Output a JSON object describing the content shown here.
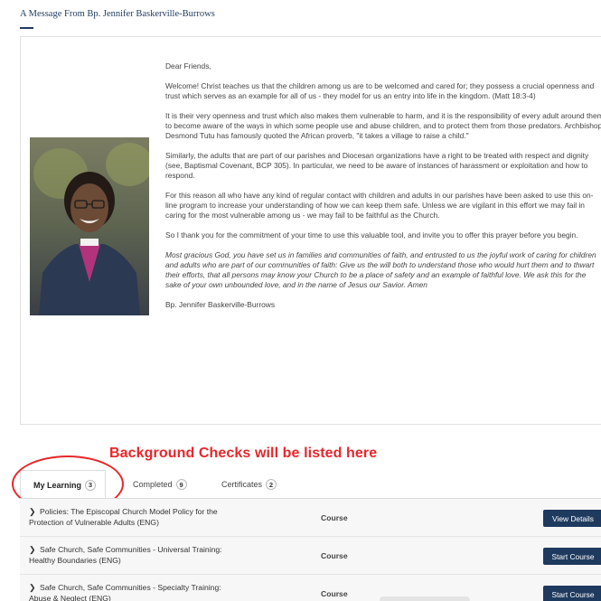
{
  "message": {
    "heading": "A Message From Bp. Jennifer Baskerville-Burrows",
    "paragraphs": [
      "Dear Friends,",
      "Welcome! Christ teaches us that the children among us are to be welcomed and cared for; they possess a crucial openness and trust which serves as an example for all of us - they model for us an entry into life in the kingdom. (Matt 18:3-4)",
      "It is their very openness and trust which also makes them vulnerable to harm, and it is the responsibility of every adult around them to become aware of the ways in which some people use and abuse children, and to protect them from those predators. Archbishop Desmond Tutu has famously quoted the African proverb, \"it takes a village to raise a child.\"",
      "Similarly, the adults that are part of our parishes and Diocesan organizations have a right to be treated with respect and dignity (see, Baptismal Covenant, BCP 305). In particular, we need to be aware of instances of harassment or exploitation and how to respond.",
      "For this reason all who have any kind of regular contact with children and adults in our parishes have been asked to use this on-line program to increase your understanding of how we can keep them safe. Unless we are vigilant in this effort we may fail in caring for the most vulnerable among us - we may fail to be faithful as the Church.",
      "So I thank you for the commitment of your time to use this valuable tool, and invite you to offer this prayer before you begin."
    ],
    "prayer": "Most gracious God, you have set us in families and communities of faith, and entrusted to us the joyful work of caring for children and adults who are part of our communities of faith: Give us the will both to understand those who would hurt them and to thwart their efforts, that all persons may know your Church to be a place of safety and an example of faithful love. We ask this for the sake of your own unbounded love, and in the name of Jesus our Savior. Amen",
    "signature": "Bp. Jennifer Baskerville-Burrows"
  },
  "annotation": "Background Checks will be listed here",
  "tabs": [
    {
      "label": "My Learning",
      "count": "3"
    },
    {
      "label": "Completed",
      "count": "9"
    },
    {
      "label": "Certificates",
      "count": "2"
    }
  ],
  "courses": [
    {
      "title": "Policies: The Episcopal Church Model Policy for the Protection of Vulnerable Adults (ENG)",
      "type": "Course",
      "action": "View Details"
    },
    {
      "title": "Safe Church, Safe Communities - Universal Training: Healthy Boundaries (ENG)",
      "type": "Course",
      "action": "Start Course"
    },
    {
      "title": "Safe Church, Safe Communities - Specialty Training: Abuse & Neglect (ENG)",
      "type": "Course",
      "action": "Start Course"
    }
  ],
  "colors": {
    "navy": "#1f3a5f",
    "annotation_red": "#e8262b"
  }
}
